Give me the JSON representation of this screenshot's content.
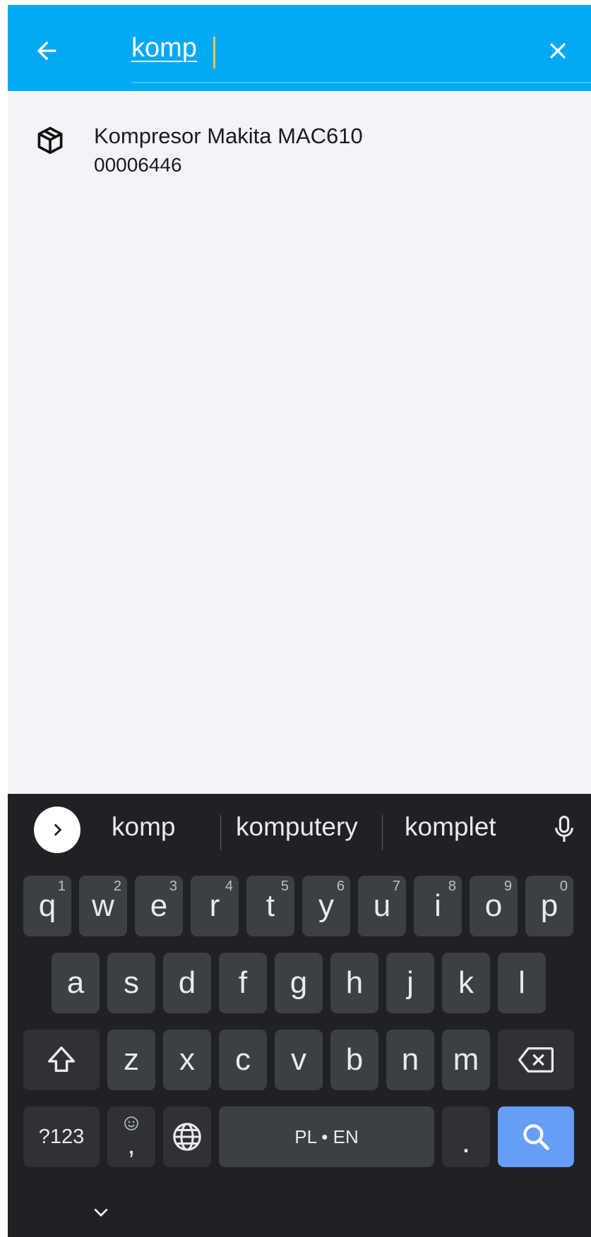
{
  "search": {
    "query": "komp",
    "back_icon": "arrow-left-icon",
    "clear_icon": "close-icon"
  },
  "results": [
    {
      "title": "Kompresor Makita MAC610",
      "code": "00006446",
      "icon": "package-icon"
    }
  ],
  "keyboard": {
    "suggestions": [
      "komp",
      "komputery",
      "komplet"
    ],
    "row1": [
      {
        "key": "q",
        "hint": "1"
      },
      {
        "key": "w",
        "hint": "2"
      },
      {
        "key": "e",
        "hint": "3"
      },
      {
        "key": "r",
        "hint": "4"
      },
      {
        "key": "t",
        "hint": "5"
      },
      {
        "key": "y",
        "hint": "6"
      },
      {
        "key": "u",
        "hint": "7"
      },
      {
        "key": "i",
        "hint": "8"
      },
      {
        "key": "o",
        "hint": "9"
      },
      {
        "key": "p",
        "hint": "0"
      }
    ],
    "row2": [
      "a",
      "s",
      "d",
      "f",
      "g",
      "h",
      "j",
      "k",
      "l"
    ],
    "row3": [
      "z",
      "x",
      "c",
      "v",
      "b",
      "n",
      "m"
    ],
    "symbols_label": "?123",
    "comma_label": ",",
    "space_label": "PL • EN",
    "period_label": "."
  },
  "colors": {
    "appbar": "#03a9f4",
    "background": "#f3f4f8",
    "keyboard": "#202124",
    "key": "#3c4043",
    "search_key": "#669df6",
    "caret": "#f5c24b"
  }
}
